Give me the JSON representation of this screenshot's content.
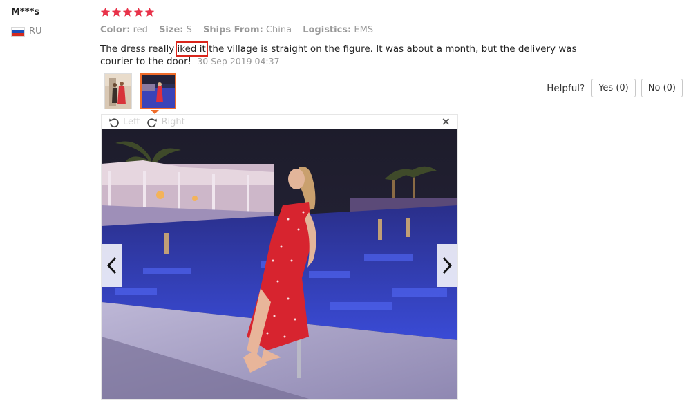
{
  "review": {
    "user_name": "M***s",
    "country_code": "RU",
    "rating": 5,
    "attributes": [
      {
        "key": "Color:",
        "value": "red"
      },
      {
        "key": "Size:",
        "value": "S"
      },
      {
        "key": "Ships From:",
        "value": "China"
      },
      {
        "key": "Logistics:",
        "value": "EMS"
      }
    ],
    "text_before": "The dress really ",
    "text_highlight": "iked it",
    "text_after": " the village is straight on the figure. It was about a month, but the delivery was courier to the door!",
    "date": "30 Sep 2019 04:37"
  },
  "helpful": {
    "label": "Helpful?",
    "yes_label": "Yes (0)",
    "no_label": "No (0)"
  },
  "viewer": {
    "rotate_left_label": "Left",
    "rotate_right_label": "Right",
    "close_glyph": "×"
  },
  "colors": {
    "star": "#e8334a",
    "accent": "#f06c2a",
    "highlight_box": "#d9261c"
  }
}
